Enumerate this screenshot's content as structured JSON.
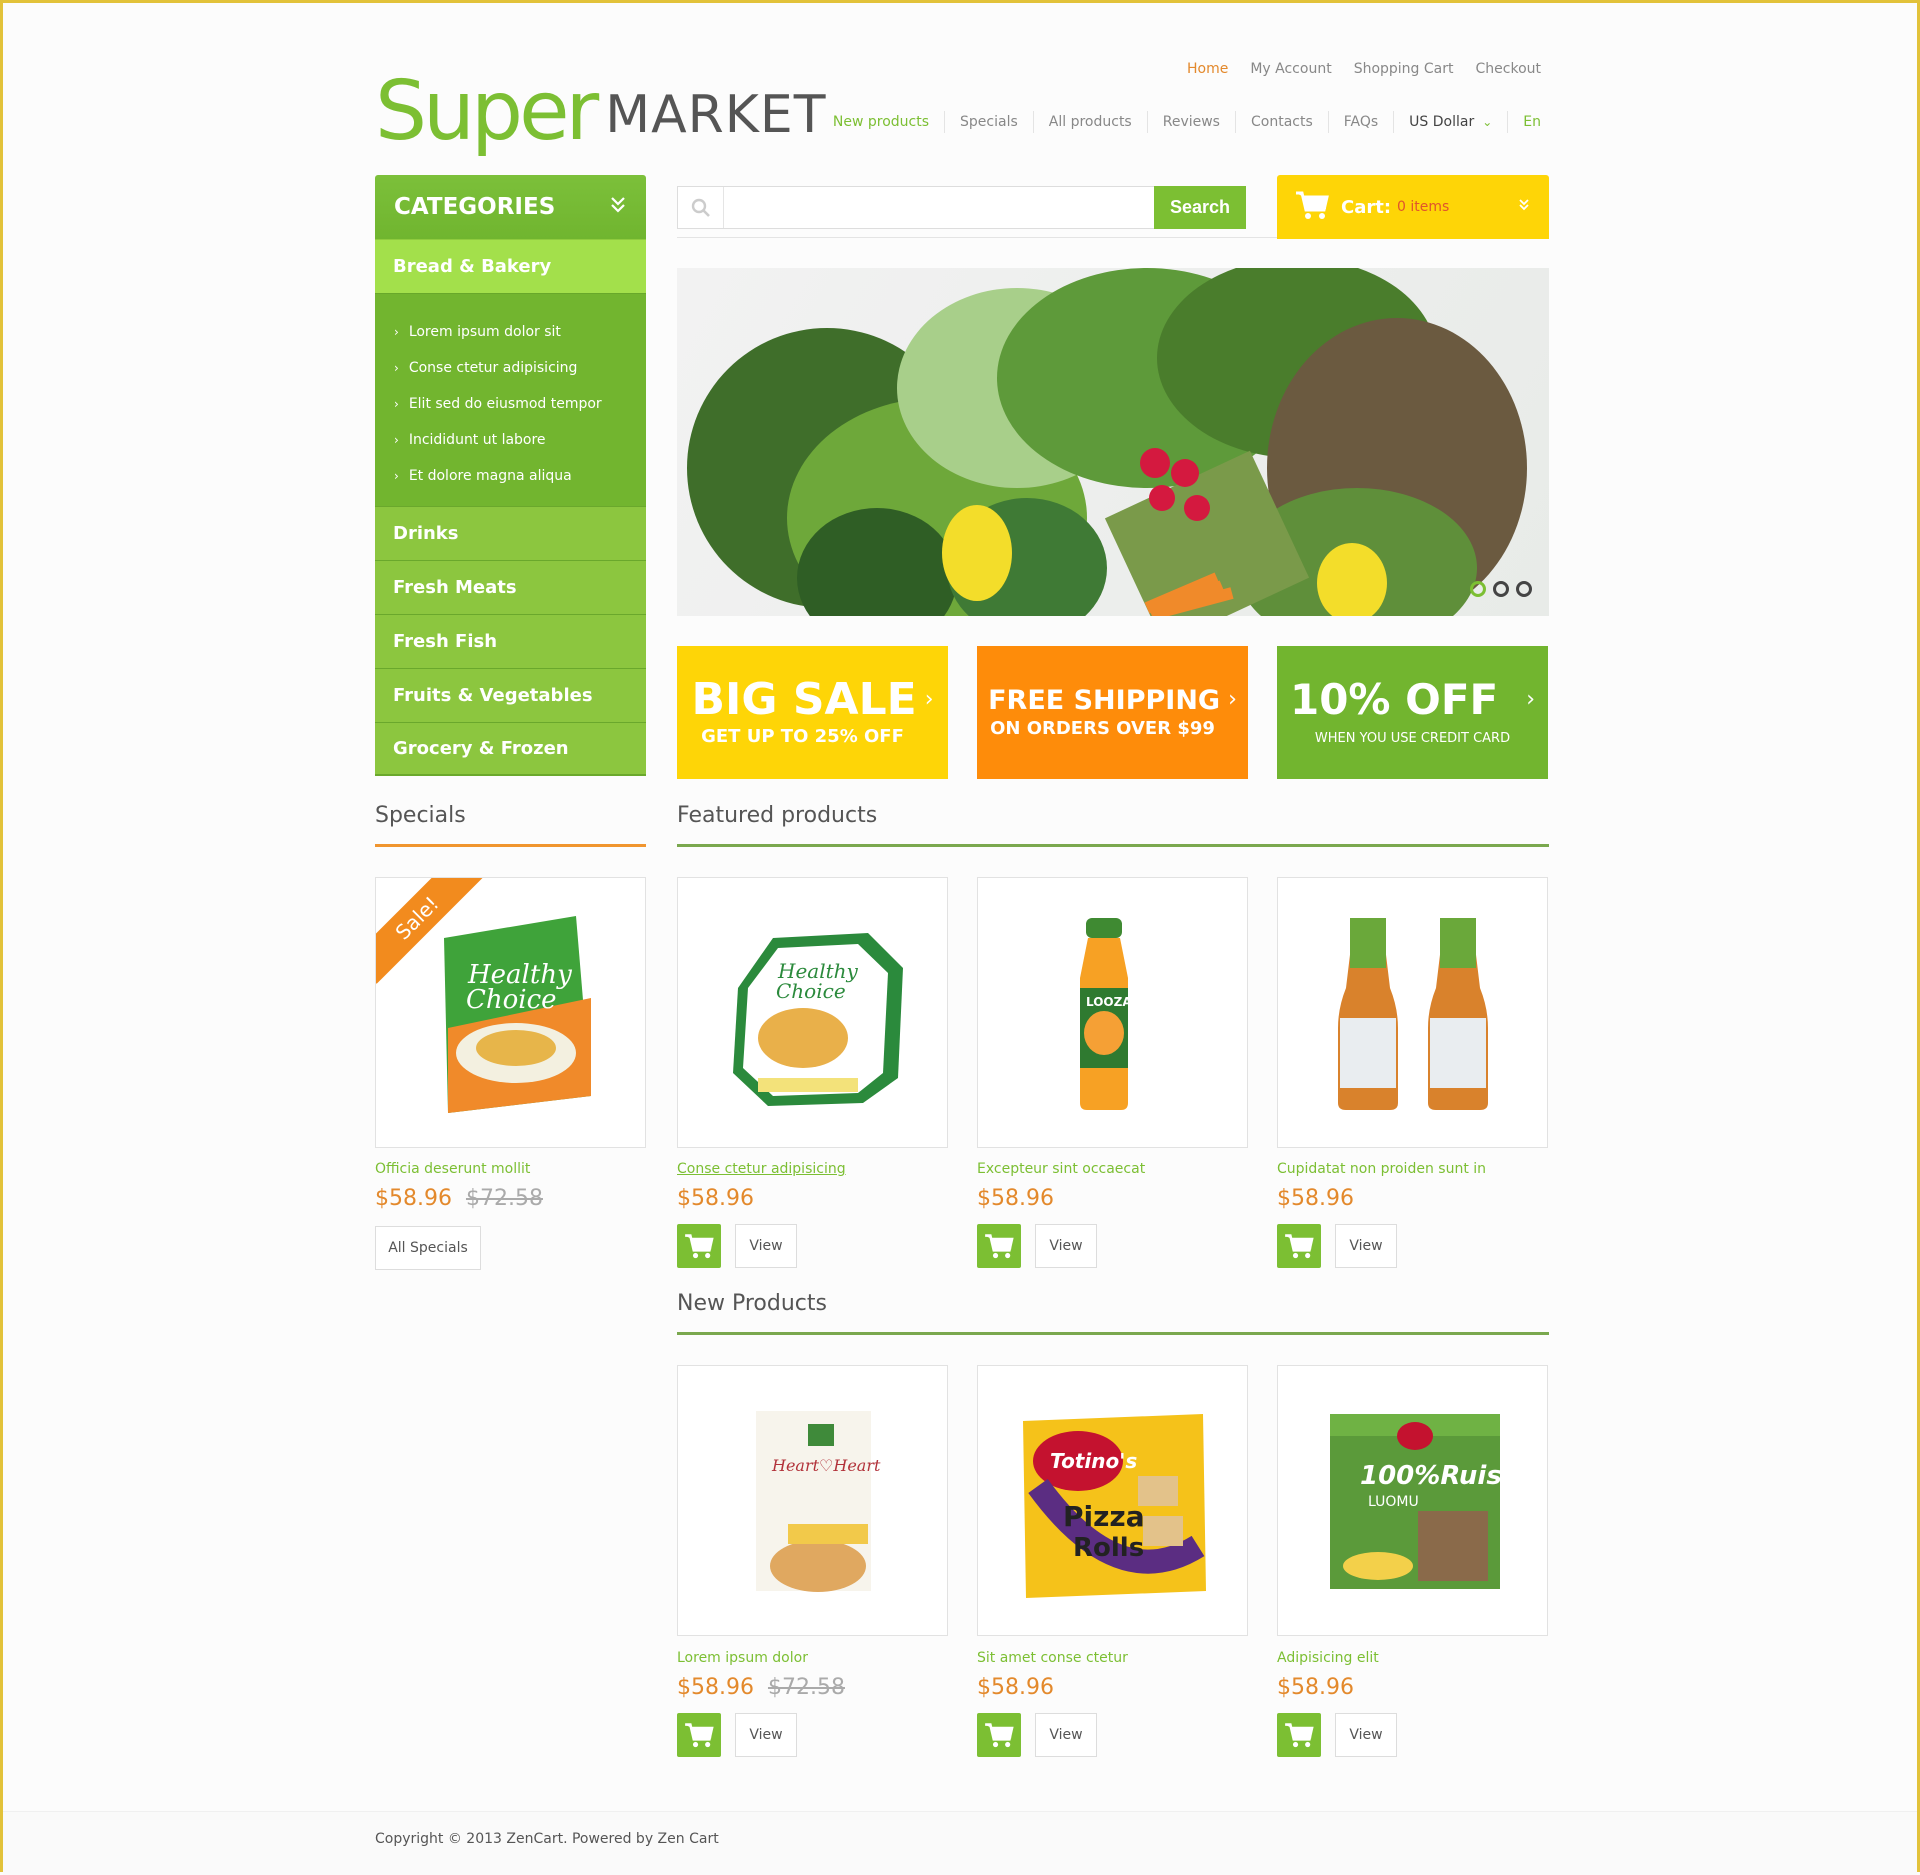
{
  "logo": {
    "super": "Super",
    "market": "MARKET"
  },
  "top_links": [
    "Home",
    "My Account",
    "Shopping Cart",
    "Checkout"
  ],
  "main_nav": [
    "New products",
    "Specials",
    "All products",
    "Reviews",
    "Contacts",
    "FAQs"
  ],
  "currency": "US Dollar",
  "language": "En",
  "categories": {
    "title": "CATEGORIES",
    "active": "Bread & Bakery",
    "subitems": [
      "Lorem ipsum dolor sit",
      "Conse ctetur adipisicing",
      "Elit sed do eiusmod tempor",
      "Incididunt ut labore",
      "Et dolore magna aliqua"
    ],
    "items": [
      "Drinks",
      "Fresh Meats",
      "Fresh Fish",
      "Fruits & Vegetables",
      "Grocery & Frozen"
    ]
  },
  "search": {
    "placeholder": "",
    "value": "",
    "button": "Search"
  },
  "cart": {
    "label": "Cart:",
    "count": "0 items"
  },
  "slider": {
    "slides": 3,
    "active_index": 0
  },
  "banners": [
    {
      "line1": "BIG SALE",
      "line2": "GET UP TO 25% OFF",
      "color": "#fed507"
    },
    {
      "line1": "FREE SHIPPING",
      "line2": "ON ORDERS OVER $99",
      "color": "#fe8c0a"
    },
    {
      "line1": "10% OFF",
      "line2": "WHEN YOU USE CREDIT CARD",
      "color": "#72b52f"
    }
  ],
  "specials": {
    "title": "Specials",
    "badge": "Sale!",
    "product": {
      "name": "Officia deserunt mollit",
      "price": "$58.96",
      "old_price": "$72.58"
    },
    "all_button": "All Specials"
  },
  "featured": {
    "title": "Featured products",
    "products": [
      {
        "name": "Conse ctetur adipisicing",
        "price": "$58.96"
      },
      {
        "name": "Excepteur sint occaecat",
        "price": "$58.96"
      },
      {
        "name": "Cupidatat non proiden sunt in",
        "price": "$58.96"
      }
    ]
  },
  "new_products": {
    "title": "New Products",
    "products": [
      {
        "name": "Lorem ipsum dolor",
        "price": "$58.96",
        "old_price": "$72.58"
      },
      {
        "name": "Sit amet conse ctetur",
        "price": "$58.96"
      },
      {
        "name": "Adipisicing elit",
        "price": "$58.96"
      }
    ]
  },
  "view_label": "View",
  "footer": {
    "copyright": "Copyright © 2013 ZenCart. Powered by Zen Cart"
  },
  "colors": {
    "green": "#7cbf33",
    "orange": "#e3892c",
    "yellow": "#fed507",
    "border": "#e2c23a"
  }
}
